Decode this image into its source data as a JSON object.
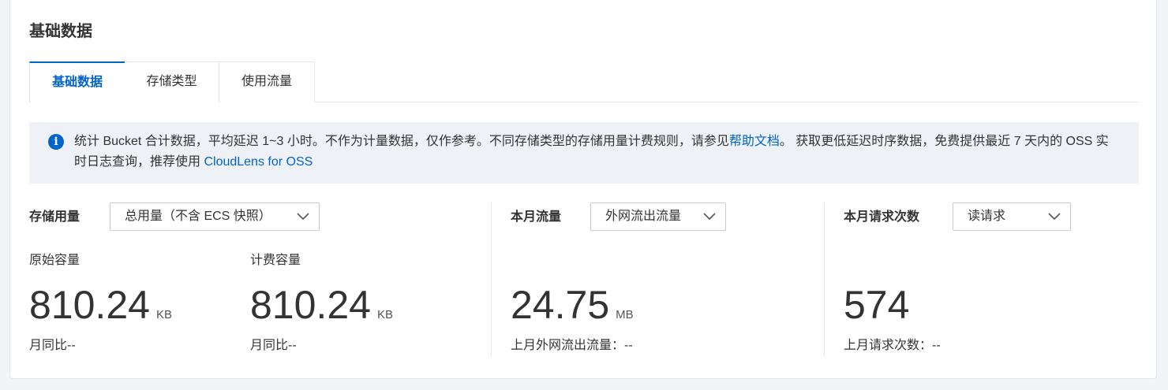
{
  "title": "基础数据",
  "tabs": [
    {
      "label": "基础数据",
      "active": true
    },
    {
      "label": "存储类型",
      "active": false
    },
    {
      "label": "使用流量",
      "active": false
    }
  ],
  "notice": {
    "text_before": "统计 Bucket 合计数据，平均延迟 1~3 小时。不作为计量数据，仅作参考。不同存储类型的存储用量计费规则，请参见",
    "help_link": "帮助文档",
    "text_middle": "。 获取更低延迟时序数据，免费提供最近 7 天内的 OSS 实时日志查询，推荐使用 ",
    "cloudlens_link": "CloudLens for OSS"
  },
  "storage": {
    "label": "存储用量",
    "select_value": "总用量（不含 ECS 快照）",
    "raw": {
      "label": "原始容量",
      "value": "810.24",
      "unit": "KB",
      "compare": "月同比--"
    },
    "billed": {
      "label": "计费容量",
      "value": "810.24",
      "unit": "KB",
      "compare": "月同比--"
    }
  },
  "traffic": {
    "label": "本月流量",
    "select_value": "外网流出流量",
    "value": "24.75",
    "unit": "MB",
    "last_month": "上月外网流出流量：--"
  },
  "requests": {
    "label": "本月请求次数",
    "select_value": "读请求",
    "value": "574",
    "last_month": "上月请求次数：--"
  },
  "colors": {
    "accent": "#0064c8",
    "notice_bg": "#eef1f6"
  }
}
